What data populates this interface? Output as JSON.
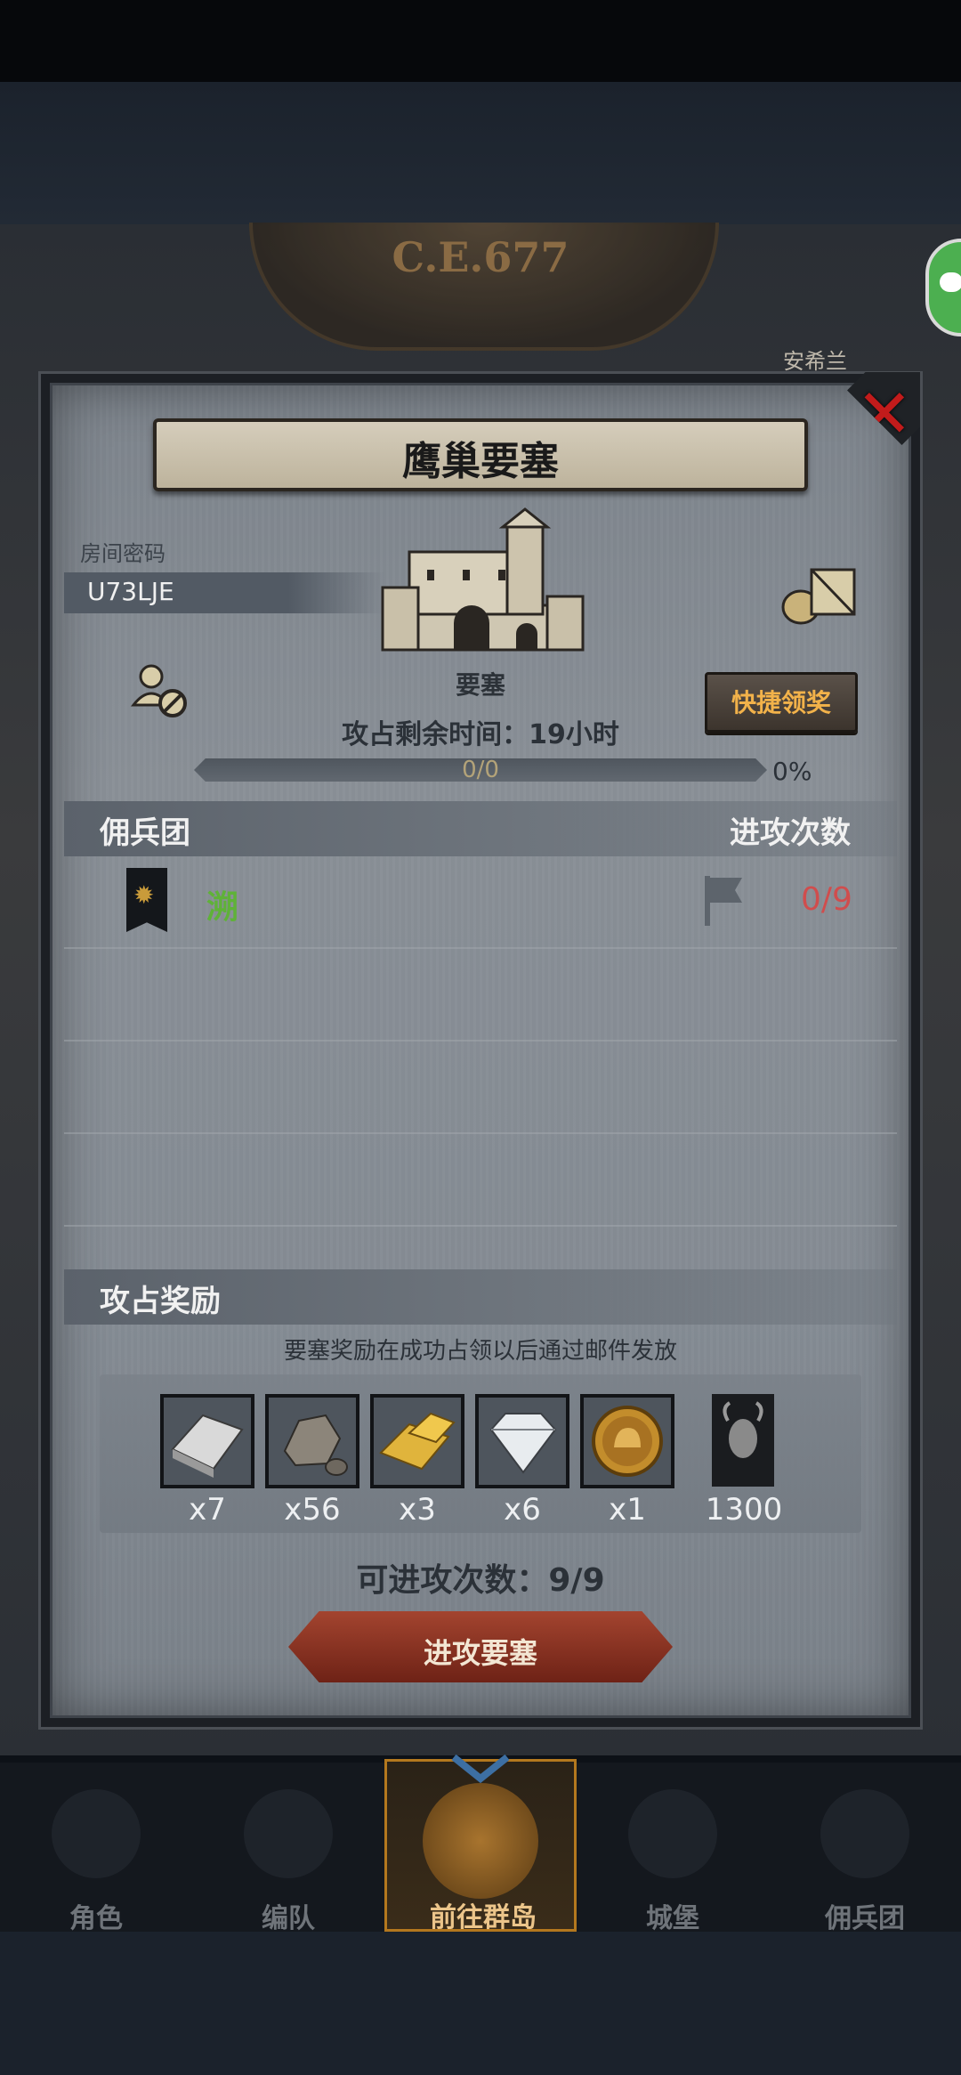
{
  "background": {
    "era": "C.E.677",
    "side_label": "安希兰"
  },
  "dialog": {
    "title": "鹰巢要塞",
    "room_code_label": "房间密码",
    "room_code": "U73LJE",
    "building_label": "要塞",
    "quick_claim_button": "快捷领奖",
    "remaining_time": "攻占剩余时间：19小时",
    "progress": {
      "text": "0/0",
      "percent": "0%",
      "fraction": 0
    },
    "mercenary_section": {
      "header": "佣兵团",
      "attacks_header": "进攻次数",
      "rows": [
        {
          "name": "溯",
          "attacks": "0/9"
        }
      ]
    },
    "reward_section": {
      "header": "攻占奖励",
      "note": "要塞奖励在成功占领以后通过邮件发放",
      "items": [
        {
          "icon": "iron-ingot-icon",
          "qty": "x7"
        },
        {
          "icon": "stone-ore-icon",
          "qty": "x56"
        },
        {
          "icon": "gold-bars-icon",
          "qty": "x3"
        },
        {
          "icon": "diamond-icon",
          "qty": "x6"
        },
        {
          "icon": "gold-medal-icon",
          "qty": "x1"
        }
      ],
      "token": {
        "icon": "bull-banner-icon",
        "qty": "1300"
      }
    },
    "attempts": "可进攻次数：9/9",
    "attack_button": "进攻要塞"
  },
  "nav": {
    "items": [
      {
        "label": "角色",
        "icon": "knight-icon"
      },
      {
        "label": "编队",
        "icon": "helmet-icon"
      },
      {
        "label": "前往群岛",
        "icon": "world-map-icon",
        "active": true
      },
      {
        "label": "城堡",
        "icon": "castle-icon"
      },
      {
        "label": "佣兵团",
        "icon": "mercenary-icon"
      }
    ]
  },
  "colors": {
    "guild_name": "#5fb238",
    "attack_count": "#d04d4d",
    "quick_claim_text": "#f2b24a",
    "close_x": "#c21b1b",
    "nav_active_border": "#b4781e"
  }
}
